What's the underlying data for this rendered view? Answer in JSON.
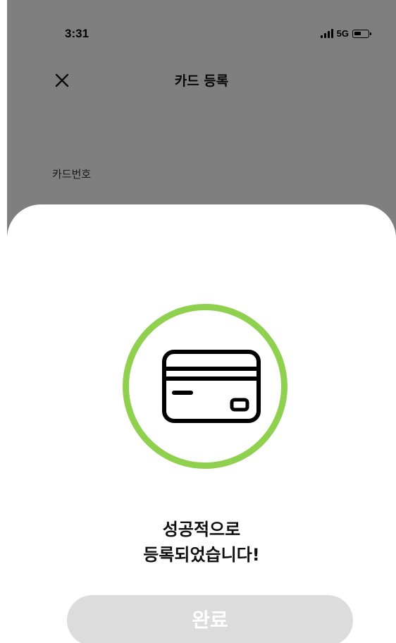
{
  "status_bar": {
    "time": "3:31",
    "network": "5G",
    "battery_level": 0.45
  },
  "header": {
    "title": "카드 등록",
    "close_icon": "close-icon"
  },
  "form": {
    "card_number_label": "카드번호"
  },
  "sheet": {
    "icon": "credit-card-icon",
    "ring_color": "#8fd14f",
    "message_line1": "성공적으로",
    "message_line2": "등록되었습니다!",
    "done_button_label": "완료",
    "done_button_color": "#dcdcdc"
  }
}
